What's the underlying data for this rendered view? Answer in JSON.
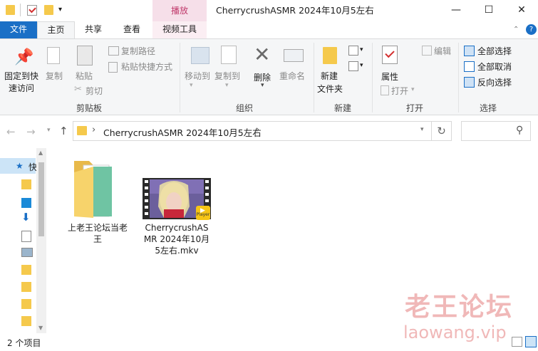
{
  "window": {
    "title": "CherrycrushASMR 2024年10月5左右",
    "context_tab": "播放",
    "controls": [
      "—",
      "☐",
      "✕"
    ]
  },
  "tabs": {
    "file": "文件",
    "home": "主页",
    "share": "共享",
    "view": "查看",
    "video_tools": "视频工具"
  },
  "ribbon": {
    "clipboard": {
      "pin_line1": "固定到快",
      "pin_line2": "速访问",
      "copy": "复制",
      "paste": "粘贴",
      "copy_path": "复制路径",
      "paste_shortcut": "粘贴快捷方式",
      "cut": "剪切",
      "label": "剪贴板"
    },
    "organize": {
      "move_to": "移动到",
      "copy_to": "复制到",
      "delete": "删除",
      "rename": "重命名",
      "label": "组织"
    },
    "new": {
      "new_folder_line1": "新建",
      "new_folder_line2": "文件夹",
      "label": "新建"
    },
    "open": {
      "properties": "属性",
      "open": "打开",
      "edit": "编辑",
      "label": "打开"
    },
    "select": {
      "select_all": "全部选择",
      "select_none": "全部取消",
      "invert": "反向选择",
      "label": "选择"
    }
  },
  "address": {
    "path": "CherrycrushASMR 2024年10月5左右",
    "separator": "›"
  },
  "navpane": {
    "quick_access_label": "快"
  },
  "items": [
    {
      "name_line1": "上老王论坛当老",
      "name_line2": "王",
      "type": "folder"
    },
    {
      "name_line1": "CherrycrushAS",
      "name_line2": "MR 2024年10月",
      "name_line3": "5左右.mkv",
      "type": "video",
      "badge": "Player"
    }
  ],
  "status": {
    "count": "2 个项目"
  },
  "watermark": {
    "line1": "老王论坛",
    "line2": "laowang.vip"
  },
  "colors": {
    "file_tab": "#1a6fc6",
    "context_tab": "#f6dfe9",
    "ribbon_bg": "#f5f6f7",
    "folder": "#f5c94c",
    "watermark": "#f0b8b8"
  }
}
